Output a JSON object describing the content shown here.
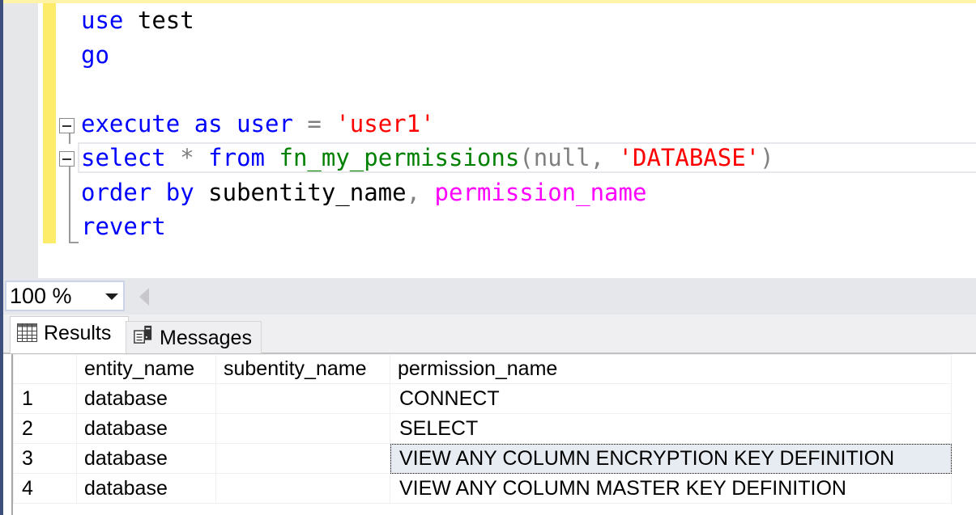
{
  "editor": {
    "lines": [
      {
        "tokens": [
          {
            "t": "use",
            "c": "kw"
          },
          {
            "t": " ",
            "c": "id"
          },
          {
            "t": "test",
            "c": "id"
          }
        ]
      },
      {
        "tokens": [
          {
            "t": "go",
            "c": "kw"
          }
        ]
      },
      {
        "tokens": []
      },
      {
        "tokens": [
          {
            "t": "execute",
            "c": "kw"
          },
          {
            "t": " ",
            "c": "id"
          },
          {
            "t": "as",
            "c": "kw"
          },
          {
            "t": " ",
            "c": "id"
          },
          {
            "t": "user",
            "c": "kw"
          },
          {
            "t": " ",
            "c": "id"
          },
          {
            "t": "=",
            "c": "op"
          },
          {
            "t": " ",
            "c": "id"
          },
          {
            "t": "'user1'",
            "c": "str"
          }
        ]
      },
      {
        "tokens": [
          {
            "t": "select",
            "c": "kw"
          },
          {
            "t": " ",
            "c": "id"
          },
          {
            "t": "*",
            "c": "op"
          },
          {
            "t": " ",
            "c": "id"
          },
          {
            "t": "from",
            "c": "kw"
          },
          {
            "t": " ",
            "c": "id"
          },
          {
            "t": "fn_my_permissions",
            "c": "fn"
          },
          {
            "t": "(",
            "c": "op"
          },
          {
            "t": "null",
            "c": "op"
          },
          {
            "t": ",",
            "c": "op"
          },
          {
            "t": " ",
            "c": "id"
          },
          {
            "t": "'DATABASE'",
            "c": "str"
          },
          {
            "t": ")",
            "c": "op"
          }
        ]
      },
      {
        "tokens": [
          {
            "t": "order",
            "c": "kw"
          },
          {
            "t": " ",
            "c": "id"
          },
          {
            "t": "by",
            "c": "kw"
          },
          {
            "t": " ",
            "c": "id"
          },
          {
            "t": "subentity_name",
            "c": "id"
          },
          {
            "t": ",",
            "c": "op"
          },
          {
            "t": " ",
            "c": "id"
          },
          {
            "t": "permission_name",
            "c": "sysfn"
          }
        ]
      },
      {
        "tokens": [
          {
            "t": "revert",
            "c": "kw"
          }
        ]
      }
    ]
  },
  "zoom": {
    "value": "100 %"
  },
  "tabs": {
    "results": {
      "label": "Results",
      "icon": "grid-icon"
    },
    "messages": {
      "label": "Messages",
      "icon": "messages-icon"
    }
  },
  "results": {
    "columns": [
      "",
      "entity_name",
      "subentity_name",
      "permission_name"
    ],
    "rows": [
      {
        "num": "1",
        "entity_name": "database",
        "subentity_name": "",
        "permission_name": "CONNECT"
      },
      {
        "num": "2",
        "entity_name": "database",
        "subentity_name": "",
        "permission_name": "SELECT"
      },
      {
        "num": "3",
        "entity_name": "database",
        "subentity_name": "",
        "permission_name": "VIEW ANY COLUMN ENCRYPTION KEY DEFINITION"
      },
      {
        "num": "4",
        "entity_name": "database",
        "subentity_name": "",
        "permission_name": "VIEW ANY COLUMN MASTER KEY DEFINITION"
      }
    ],
    "selected_cell": "3.permission_name"
  }
}
